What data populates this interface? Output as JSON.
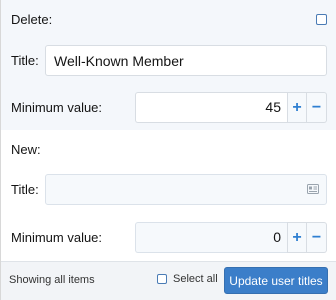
{
  "delete_block": {
    "header": "Delete:",
    "title_label": "Title:",
    "title_value": "Well-Known Member",
    "min_label": "Minimum value:",
    "min_value": "45",
    "plus_label": "+",
    "minus_label": "−"
  },
  "new_block": {
    "header": "New:",
    "title_label": "Title:",
    "title_value": "",
    "min_label": "Minimum value:",
    "min_value": "0",
    "plus_label": "+",
    "minus_label": "−"
  },
  "footer": {
    "status_text": "Showing all items",
    "select_all_label": "Select all",
    "update_button_label": "Update user titles"
  },
  "icons": {
    "delete_checkbox": "checkbox-icon",
    "title_card": "id-card-icon",
    "select_all_checkbox": "checkbox-icon"
  },
  "colors": {
    "accent": "#3b7ec9",
    "stepper_glyph": "#2f7fd1",
    "checkbox_border": "#4a7bb5"
  }
}
